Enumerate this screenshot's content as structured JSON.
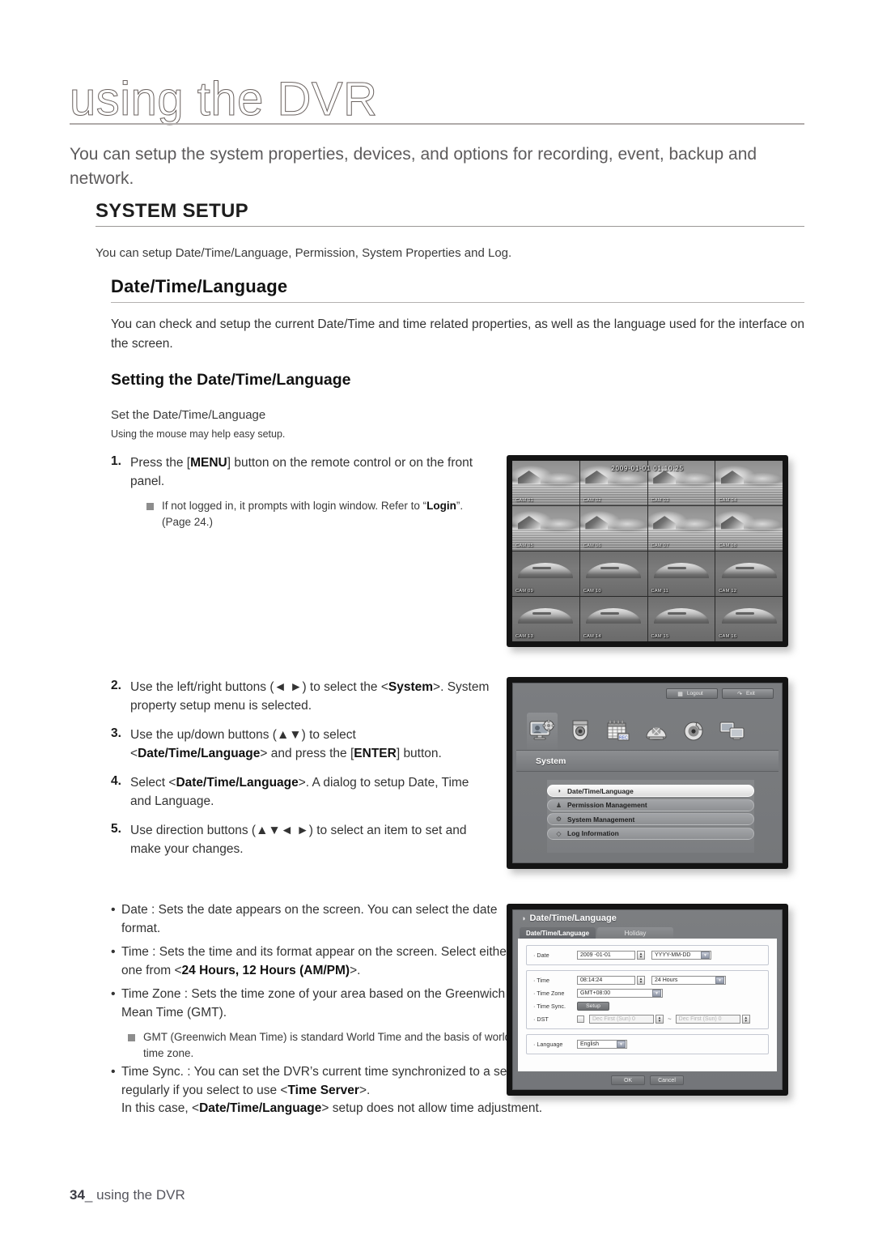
{
  "page": {
    "chapter_title": "using the DVR",
    "intro": "You can setup the system properties, devices, and options for recording, event, backup and network.",
    "footer_page": "34",
    "footer_sep": "_",
    "footer_label": "using the DVR"
  },
  "system_setup": {
    "heading": "SYSTEM SETUP",
    "lead": "You can setup Date/Time/Language, Permission, System Properties and Log."
  },
  "datetime_section": {
    "heading": "Date/Time/Language",
    "paragraph": "You can check and setup the current Date/Time and time related properties, as well as the language used for the interface on the screen.",
    "sub_heading": "Setting the Date/Time/Language",
    "line1": "Set the Date/Time/Language",
    "line2": "Using the mouse may help easy setup."
  },
  "steps_group_1": [
    {
      "num": "1.",
      "text_a": "Press the [",
      "bold_a": "MENU",
      "text_b": "] button on the remote control or on the front panel.",
      "note_a": "If not logged in, it prompts with login window. Refer to “",
      "note_bold": "Login",
      "note_b": "”. (Page 24.)"
    }
  ],
  "steps_group_2": [
    {
      "num": "2.",
      "a": "Use the left/right buttons (◄ ►) to select the <",
      "bold": "System",
      "b": ">. System property setup menu is selected."
    },
    {
      "num": "3.",
      "a": "Use the up/down buttons (▲▼) to select <",
      "bold": "Date/Time/Language",
      "b": "> and press the [",
      "bold2": "ENTER",
      "c": "] button."
    },
    {
      "num": "4.",
      "a": "Select <",
      "bold": "Date/Time/Language",
      "b": ">. A dialog to setup Date, Time and Language."
    },
    {
      "num": "5.",
      "a": "Use direction buttons (▲▼◄ ►) to select an item to set and make your changes.",
      "bold": "",
      "b": ""
    }
  ],
  "bullets": {
    "date": {
      "a": "Date : Sets the date appears on the screen. You can select the date format."
    },
    "time": {
      "a": "Time : Sets the time and its format appear on the screen. Select either one from <",
      "bold": "24 Hours, 12 Hours (AM/PM)",
      "b": ">."
    },
    "timezone": {
      "a": "Time Zone : Sets the time zone of your area based on the Greenwich Mean Time (GMT).",
      "note": "GMT (Greenwich Mean Time) is standard World Time and the basis of world time zone."
    },
    "timesync": {
      "a": "Time Sync. : You can set the DVR’s current time synchronized to a selected <",
      "bold": "Time Server",
      "b": "> regularly if you select to use <",
      "bold2": "Time Server",
      "c": ">.",
      "d": "In this case, <",
      "bold3": "Date/Time/Language",
      "e": "> setup does not allow time adjustment."
    }
  },
  "shot_live": {
    "osd_time": "2009-01-01 01:10:25",
    "cameras": [
      {
        "label": "CAM 01",
        "scene": "house"
      },
      {
        "label": "CAM 02",
        "scene": "house"
      },
      {
        "label": "CAM 03",
        "scene": "house"
      },
      {
        "label": "CAM 04",
        "scene": "house"
      },
      {
        "label": "CAM 05",
        "scene": "house"
      },
      {
        "label": "CAM 06",
        "scene": "house"
      },
      {
        "label": "CAM 07",
        "scene": "house"
      },
      {
        "label": "CAM 08",
        "scene": "house"
      },
      {
        "label": "CAM 09",
        "scene": "arc"
      },
      {
        "label": "CAM 10",
        "scene": "arc"
      },
      {
        "label": "CAM 11",
        "scene": "arc"
      },
      {
        "label": "CAM 12",
        "scene": "arc"
      },
      {
        "label": "CAM 13",
        "scene": "arc"
      },
      {
        "label": "CAM 14",
        "scene": "arc"
      },
      {
        "label": "CAM 15",
        "scene": "arc"
      },
      {
        "label": "CAM 16",
        "scene": "arc"
      }
    ]
  },
  "shot_menu": {
    "logout_label": "Logout",
    "exit_label": "Exit",
    "title": "System",
    "icons": [
      {
        "name": "system-icon",
        "active": true
      },
      {
        "name": "camera-icon",
        "active": false
      },
      {
        "name": "record-schedule-icon",
        "active": false
      },
      {
        "name": "ptz-dome-icon",
        "active": false
      },
      {
        "name": "backup-disc-icon",
        "active": false
      },
      {
        "name": "network-icon",
        "active": false
      }
    ],
    "items": [
      {
        "label": "Date/Time/Language",
        "icon": "globe-icon",
        "glyph": "◑",
        "selected": true
      },
      {
        "label": "Permission Management",
        "icon": "user-icon",
        "glyph": "♟",
        "selected": false
      },
      {
        "label": "System Management",
        "icon": "gear-icon",
        "glyph": "⚙",
        "selected": false
      },
      {
        "label": "Log Information",
        "icon": "diamond-icon",
        "glyph": "◇",
        "selected": false
      }
    ]
  },
  "shot_dialog": {
    "title": "Date/Time/Language",
    "tabs": [
      {
        "label": "Date/Time/Language",
        "active": true
      },
      {
        "label": "Holiday",
        "active": false
      }
    ],
    "fields": {
      "date_label": "Date",
      "date_value": "2009 -01-01",
      "date_format": "YYYY-MM-DD",
      "time_label": "Time",
      "time_value": "08:14:24",
      "time_format": "24 Hours",
      "timezone_label": "Time Zone",
      "timezone_value": "GMT+08:00",
      "timesync_label": "Time Sync.",
      "timesync_button": "Setup",
      "dst_label": "DST",
      "dst_from": "Dec First (Sun) 0",
      "dst_to": "Dec First (Sun) 0",
      "dst_sep": "~",
      "language_label": "Language",
      "language_value": "English"
    },
    "buttons": {
      "ok": "OK",
      "cancel": "Cancel"
    }
  }
}
